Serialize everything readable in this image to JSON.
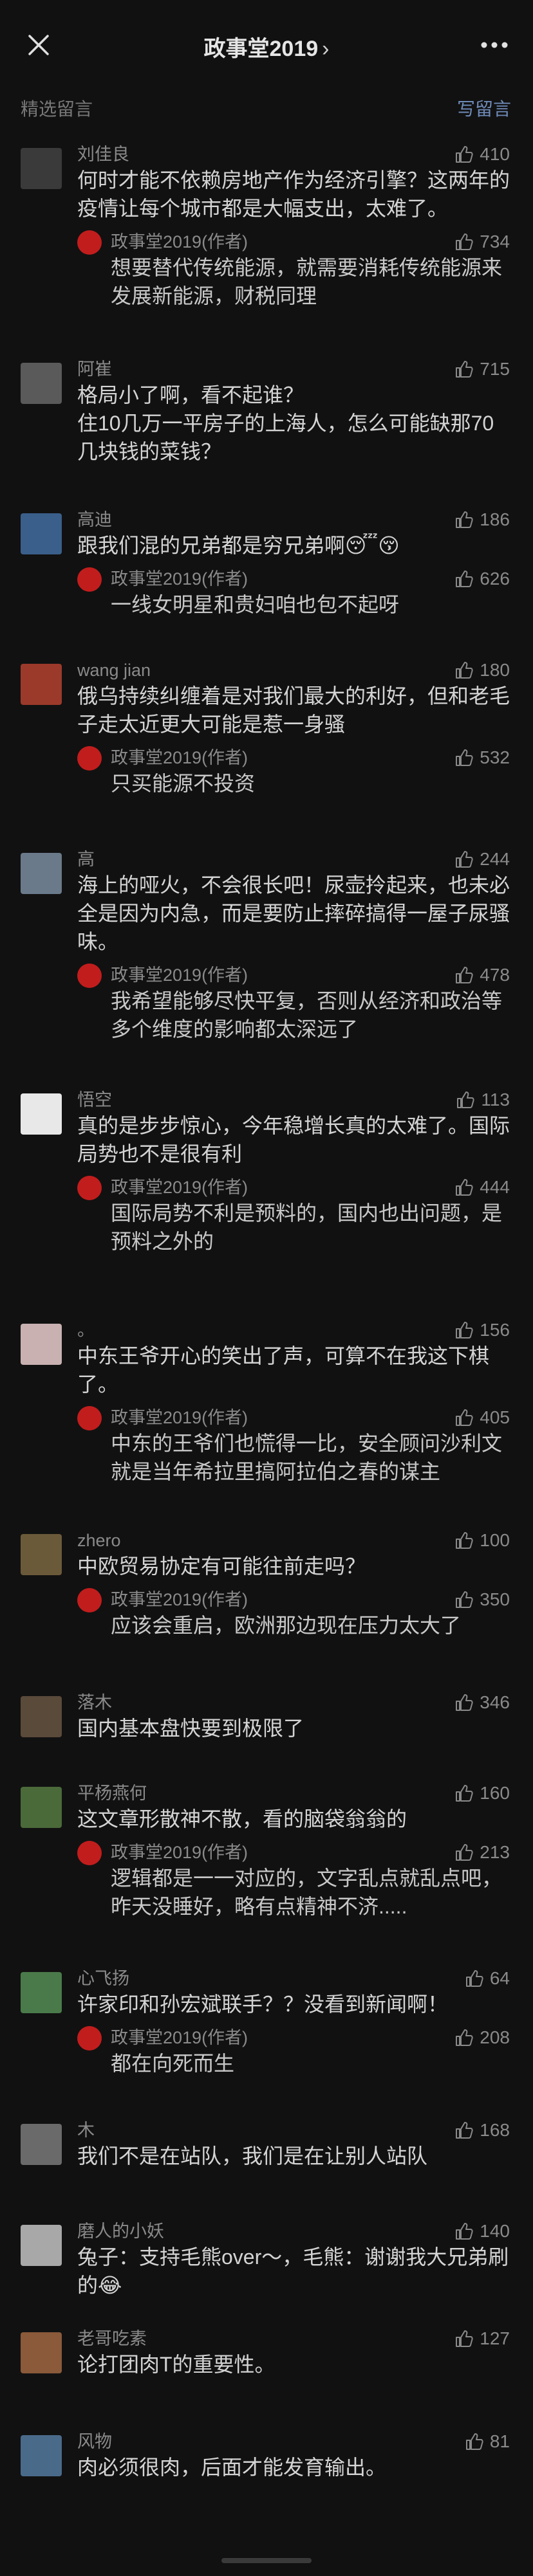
{
  "nav": {
    "title": "政事堂2019",
    "chevron": "›"
  },
  "section": {
    "label": "精选留言",
    "write": "写留言"
  },
  "comments": [
    {
      "name": "刘佳良",
      "text": "何时才能不依赖房地产作为经济引擎？这两年的疫情让每个城市都是大幅支出，太难了。",
      "likes": "410",
      "reply": {
        "name": "政事堂2019(作者)",
        "text": "想要替代传统能源，就需要消耗传统能源来发展新能源，财税同理",
        "likes": "734"
      }
    },
    {
      "name": "阿崔",
      "text": "格局小了啊，看不起谁？\n住10几万一平房子的上海人，怎么可能缺那70几块钱的菜钱？",
      "likes": "715"
    },
    {
      "name": "高迪",
      "text": "跟我们混的兄弟都是穷兄弟啊😴😚",
      "likes": "186",
      "reply": {
        "name": "政事堂2019(作者)",
        "text": "一线女明星和贵妇咱也包不起呀",
        "likes": "626"
      }
    },
    {
      "name": "wang jian",
      "text": "俄乌持续纠缠着是对我们最大的利好，但和老毛子走太近更大可能是惹一身骚",
      "likes": "180",
      "reply": {
        "name": "政事堂2019(作者)",
        "text": "只买能源不投资",
        "likes": "532"
      }
    },
    {
      "name": "高",
      "text": "海上的哑火，不会很长吧！尿壶拎起来，也未必全是因为内急，而是要防止摔碎搞得一屋子尿骚味。",
      "likes": "244",
      "reply": {
        "name": "政事堂2019(作者)",
        "text": "我希望能够尽快平复，否则从经济和政治等多个维度的影响都太深远了",
        "likes": "478"
      }
    },
    {
      "name": "悟空",
      "text": "真的是步步惊心，今年稳增长真的太难了。国际局势也不是很有利",
      "likes": "113",
      "reply": {
        "name": "政事堂2019(作者)",
        "text": "国际局势不利是预料的，国内也出问题，是预料之外的",
        "likes": "444"
      }
    },
    {
      "name": "。",
      "text": "中东王爷开心的笑出了声，可算不在我这下棋了。",
      "likes": "156",
      "reply": {
        "name": "政事堂2019(作者)",
        "text": "中东的王爷们也慌得一比，安全顾问沙利文就是当年希拉里搞阿拉伯之春的谋主",
        "likes": "405"
      }
    },
    {
      "name": "zhero",
      "text": "中欧贸易协定有可能往前走吗？",
      "likes": "100",
      "reply": {
        "name": "政事堂2019(作者)",
        "text": "应该会重启，欧洲那边现在压力太大了",
        "likes": "350"
      }
    },
    {
      "name": "落木",
      "text": "国内基本盘快要到极限了",
      "likes": "346"
    },
    {
      "name": "平杨燕何",
      "text": "这文章形散神不散，看的脑袋翁翁的",
      "likes": "160",
      "reply": {
        "name": "政事堂2019(作者)",
        "text": "逻辑都是一一对应的，文字乱点就乱点吧，昨天没睡好，略有点精神不济.....",
        "likes": "213"
      }
    },
    {
      "name": "心飞扬",
      "text": "许家印和孙宏斌联手？？没看到新闻啊！",
      "likes": "64",
      "reply": {
        "name": "政事堂2019(作者)",
        "text": "都在向死而生",
        "likes": "208"
      }
    },
    {
      "name": "木",
      "text": "我们不是在站队，我们是在让别人站队",
      "likes": "168"
    },
    {
      "name": "磨人的小妖",
      "text": "兔子：支持毛熊over～，毛熊：谢谢我大兄弟刷的😂",
      "likes": "140"
    },
    {
      "name": "老哥吃素",
      "text": "论打团肉T的重要性。",
      "likes": "127"
    },
    {
      "name": "风物",
      "text": "肉必须很肉，后面才能发育输出。",
      "likes": "81"
    }
  ],
  "colors": {
    "accent": "#6e8ab8",
    "author_badge": "#c21d1d"
  },
  "icons": [
    "close-icon",
    "more-icon",
    "thumb-up-icon"
  ]
}
